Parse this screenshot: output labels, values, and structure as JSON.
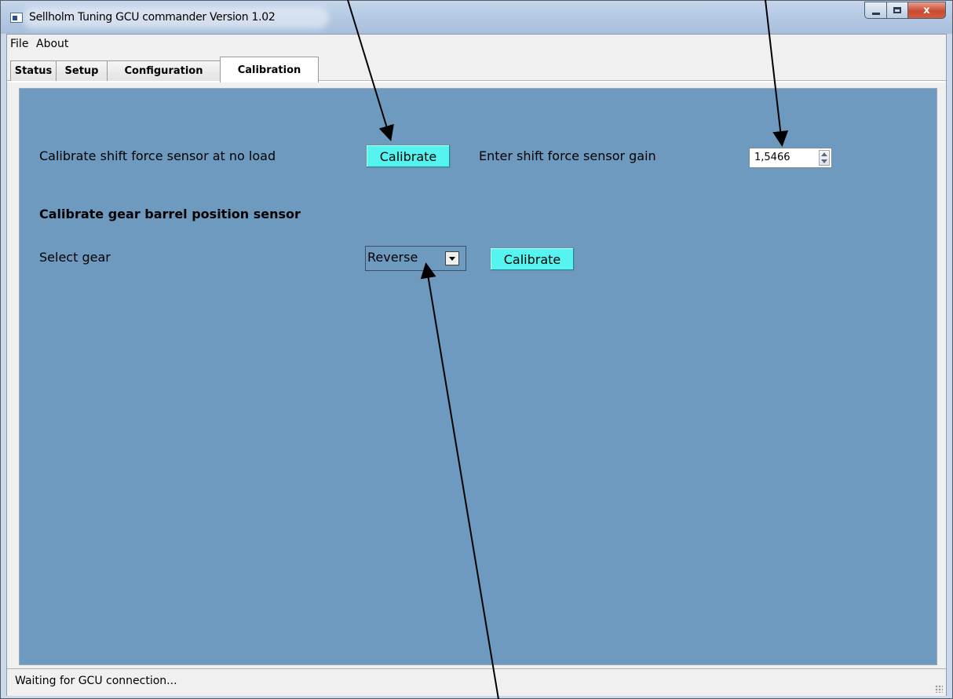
{
  "window": {
    "title": "Sellholm Tuning GCU commander Version 1.02",
    "icon": "app-window-icon",
    "controls": {
      "minimize": "minimize-icon",
      "maximize": "maximize-icon",
      "close": "x"
    }
  },
  "menu": [
    {
      "label": "File"
    },
    {
      "label": "About"
    }
  ],
  "tabs": [
    {
      "label": "Status",
      "active": false
    },
    {
      "label": "Setup",
      "active": false
    },
    {
      "label": "Configuration",
      "active": false
    },
    {
      "label": "Calibration",
      "active": true
    }
  ],
  "calibration": {
    "shift_force": {
      "label": "Calibrate shift force sensor at no load",
      "button": "Calibrate",
      "gain_label": "Enter shift force sensor gain",
      "gain_value": "1,5466"
    },
    "gear_barrel": {
      "heading": "Calibrate gear barrel position sensor",
      "select_label": "Select gear",
      "selected_gear": "Reverse",
      "button": "Calibrate"
    }
  },
  "status_bar": {
    "text": "Waiting for GCU connection..."
  },
  "colors": {
    "panel": "#6f9ac0",
    "calibrate_button": "#55f4f0",
    "window_chrome": "#b6cae4",
    "close_button": "#c94a32"
  }
}
